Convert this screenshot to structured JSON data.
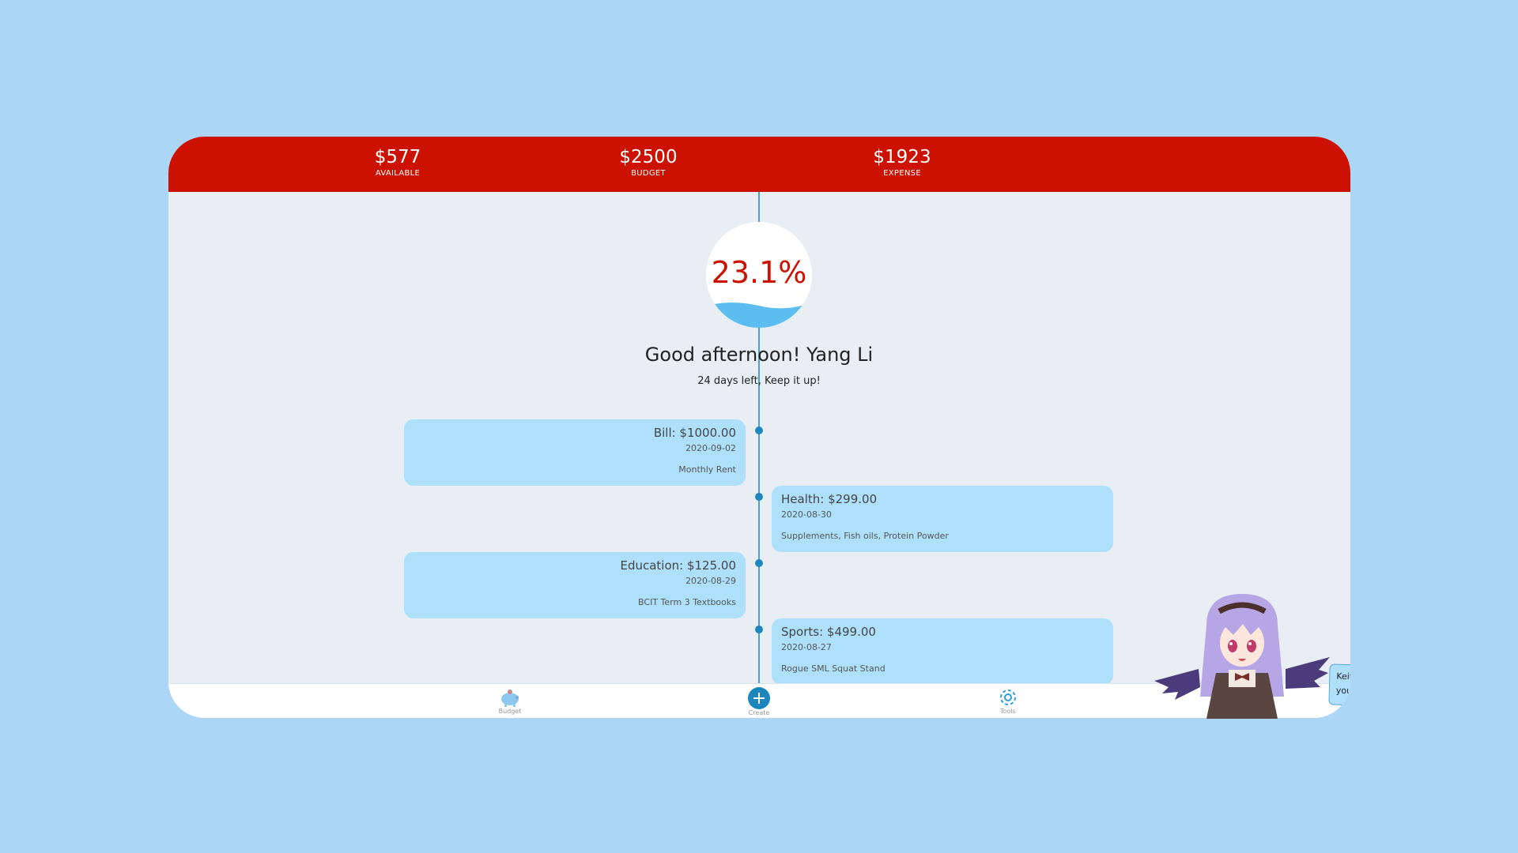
{
  "header": {
    "stats": [
      {
        "amount": "$577",
        "label": "AVAILABLE"
      },
      {
        "amount": "$2500",
        "label": "BUDGET"
      },
      {
        "amount": "$1923",
        "label": "EXPENSE"
      }
    ]
  },
  "progress": {
    "percent_text": "23.1%",
    "fill_fraction": 0.231
  },
  "greeting": "Good afternoon! Yang Li",
  "subtext": "24 days left, Keep it up!",
  "entries": [
    {
      "title": "Bill: $1000.00",
      "date": "2020-09-02",
      "note": "Monthly Rent",
      "side": "left"
    },
    {
      "title": "Health: $299.00",
      "date": "2020-08-30",
      "note": "Supplements, Fish oils, Protein Powder",
      "side": "right"
    },
    {
      "title": "Education: $125.00",
      "date": "2020-08-29",
      "note": "BCIT Term 3 Textbooks",
      "side": "left"
    },
    {
      "title": "Sports: $499.00",
      "date": "2020-08-27",
      "note": "Rogue SML Squat Stand",
      "side": "right"
    }
  ],
  "nav": [
    {
      "label": "Budget",
      "icon": "piggy-bank-icon"
    },
    {
      "label": "Create",
      "icon": "plus-icon"
    },
    {
      "label": "Tools",
      "icon": "gear-icon"
    }
  ],
  "assistant": {
    "message": "Keith: make sure you open up your checkstyle ~",
    "icons": [
      "chat-icon",
      "pin-icon",
      "camera-icon",
      "info-icon",
      "close-icon"
    ]
  },
  "colors": {
    "page_bg": "#abd6f5",
    "header_red": "#cc1100",
    "card_blue": "#aee0fc",
    "accent_blue": "#1e86bf"
  }
}
